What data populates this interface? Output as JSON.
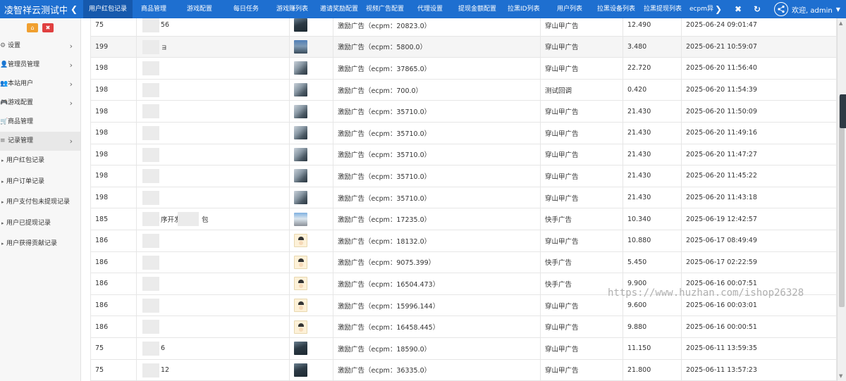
{
  "app": {
    "brand": "凌智祥云测试中"
  },
  "topnav": [
    "用户红包记录",
    "商品管理",
    "游戏配置",
    "每日任务",
    "游戏赚列表",
    "邀请奖励配置",
    "视频广告配置",
    "代理设置",
    "提现金额配置",
    "拉黑ID列表",
    "用户列表",
    "拉黑设备列表",
    "拉黑提现列表",
    "ecpm异"
  ],
  "header": {
    "welcome": "欢迎, admin",
    "icons": [
      "chevron-left-icon",
      "chevron-right-icon",
      "close-icon",
      "refresh-icon",
      "share-icon"
    ]
  },
  "sidebar": {
    "tools": {
      "home": "⌂",
      "delete": "🗑"
    },
    "items": [
      {
        "label": "设置",
        "has_arrow": true
      },
      {
        "label": "管理员管理",
        "has_arrow": true
      },
      {
        "label": "本站用户",
        "has_arrow": true
      },
      {
        "label": "游戏配置",
        "has_arrow": true
      },
      {
        "label": "商品管理",
        "has_arrow": false
      },
      {
        "label": "记录管理",
        "has_arrow": true
      }
    ],
    "subitems": [
      "用户红包记录",
      "用户订单记录",
      "用户支付包未提现记录",
      "用户已提现记录",
      "用户获得贡献记录"
    ]
  },
  "table": {
    "rows": [
      {
        "uid": "75",
        "name": "56",
        "thumb": "dark",
        "type": "激励广告（ecpm：20823.0）",
        "source": "穿山甲广告",
        "amount": "12.490",
        "time": "2025-06-24 09:01:47"
      },
      {
        "uid": "199",
        "name": "ョ",
        "thumb": "mtn",
        "type": "激励广告（ecpm：5800.0）",
        "source": "穿山甲广告",
        "amount": "3.480",
        "time": "2025-06-21 10:59:07"
      },
      {
        "uid": "198",
        "name": "",
        "thumb": "rock",
        "type": "激励广告（ecpm：37865.0）",
        "source": "穿山甲广告",
        "amount": "22.720",
        "time": "2025-06-20 11:56:40"
      },
      {
        "uid": "198",
        "name": "",
        "thumb": "rock",
        "type": "激励广告（ecpm：700.0）",
        "source": "测试回调",
        "amount": "0.420",
        "time": "2025-06-20 11:54:39"
      },
      {
        "uid": "198",
        "name": "",
        "thumb": "rock",
        "type": "激励广告（ecpm：35710.0）",
        "source": "穿山甲广告",
        "amount": "21.430",
        "time": "2025-06-20 11:50:09"
      },
      {
        "uid": "198",
        "name": "",
        "thumb": "rock",
        "type": "激励广告（ecpm：35710.0）",
        "source": "穿山甲广告",
        "amount": "21.430",
        "time": "2025-06-20 11:49:16"
      },
      {
        "uid": "198",
        "name": "",
        "thumb": "rock",
        "type": "激励广告（ecpm：35710.0）",
        "source": "穿山甲广告",
        "amount": "21.430",
        "time": "2025-06-20 11:47:27"
      },
      {
        "uid": "198",
        "name": "",
        "thumb": "rock",
        "type": "激励广告（ecpm：35710.0）",
        "source": "穿山甲广告",
        "amount": "21.430",
        "time": "2025-06-20 11:45:22"
      },
      {
        "uid": "198",
        "name": "",
        "thumb": "rock",
        "type": "激励广告（ecpm：35710.0）",
        "source": "穿山甲广告",
        "amount": "21.430",
        "time": "2025-06-20 11:43:18"
      },
      {
        "uid": "185",
        "name": "序开发",
        "name_tail": "包",
        "thumb": "sky",
        "type": "激励广告（ecpm：17235.0）",
        "source": "快手广告",
        "amount": "10.340",
        "time": "2025-06-19 12:42:57"
      },
      {
        "uid": "186",
        "name": "",
        "thumb": "face",
        "type": "激励广告（ecpm：18132.0）",
        "source": "穿山甲广告",
        "amount": "10.880",
        "time": "2025-06-17 08:49:49"
      },
      {
        "uid": "186",
        "name": "",
        "thumb": "face",
        "type": "激励广告（ecpm：9075.399）",
        "source": "快手广告",
        "amount": "5.450",
        "time": "2025-06-17 02:22:59"
      },
      {
        "uid": "186",
        "name": "",
        "thumb": "face",
        "type": "激励广告（ecpm：16504.473）",
        "source": "快手广告",
        "amount": "9.900",
        "time": "2025-06-16 00:07:51"
      },
      {
        "uid": "186",
        "name": "",
        "thumb": "face",
        "type": "激励广告（ecpm：15996.144）",
        "source": "穿山甲广告",
        "amount": "9.600",
        "time": "2025-06-16 00:03:01"
      },
      {
        "uid": "186",
        "name": "",
        "thumb": "face",
        "type": "激励广告（ecpm：16458.445）",
        "source": "穿山甲广告",
        "amount": "9.880",
        "time": "2025-06-16 00:00:51"
      },
      {
        "uid": "75",
        "name": "6",
        "thumb": "dark",
        "type": "激励广告（ecpm：18590.0）",
        "source": "穿山甲广告",
        "amount": "11.150",
        "time": "2025-06-11 13:59:35"
      },
      {
        "uid": "75",
        "name": "12",
        "thumb": "dark",
        "type": "激励广告（ecpm：36335.0）",
        "source": "穿山甲广告",
        "amount": "21.800",
        "time": "2025-06-11 13:57:23"
      }
    ]
  },
  "watermark": "https://www.huzhan.com/ishop26328"
}
